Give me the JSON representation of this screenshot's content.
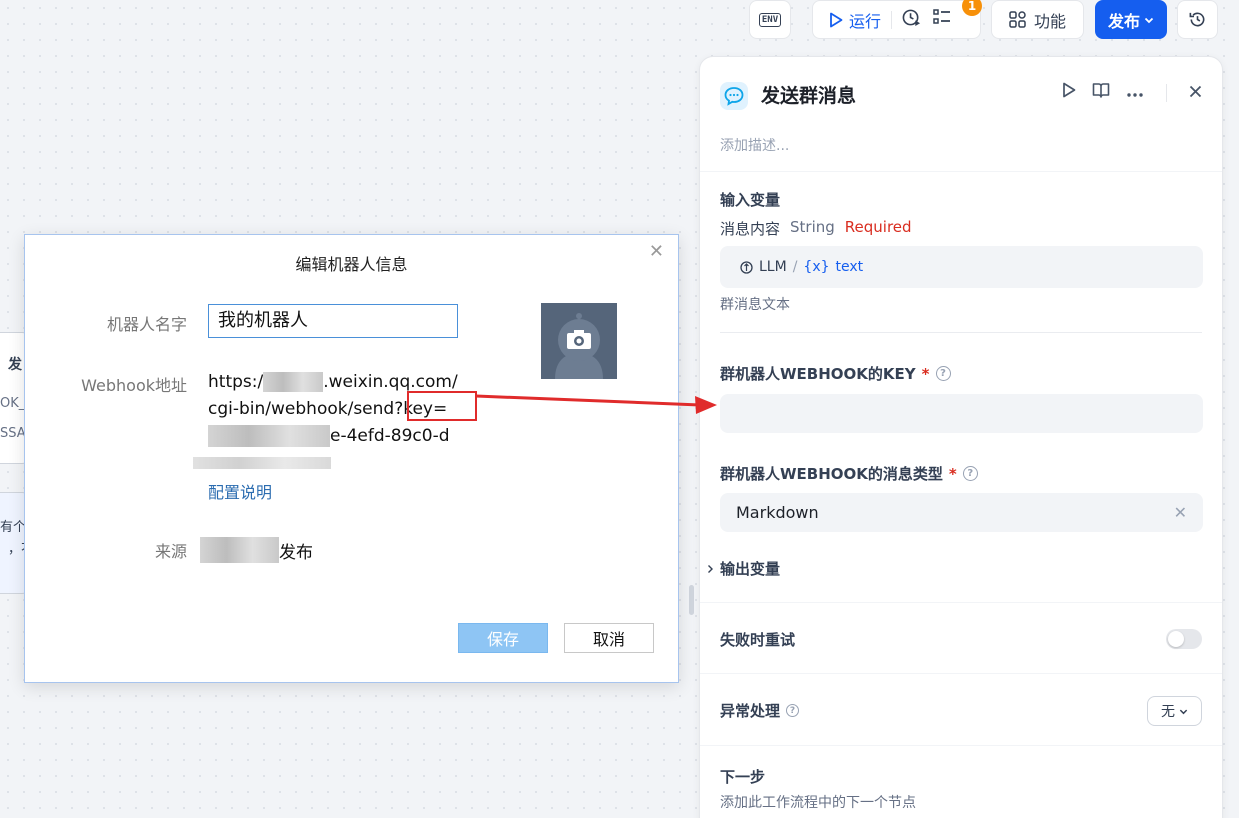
{
  "toolbar": {
    "env_icon": "ENV",
    "run_label": "运行",
    "badge_count": "1",
    "features_label": "功能",
    "publish_label": "发布"
  },
  "panel": {
    "title": "发送群消息",
    "description_placeholder": "添加描述...",
    "input_vars_title": "输入变量",
    "var_name": "消息内容",
    "var_type": "String",
    "var_required": "Required",
    "var_source": "LLM",
    "var_ref": "text",
    "var_hint": "群消息文本",
    "webhook_key_label": "群机器人WEBHOOK的KEY",
    "msg_type_label": "群机器人WEBHOOK的消息类型",
    "msg_type_value": "Markdown",
    "output_vars_title": "输出变量",
    "retry_label": "失败时重试",
    "error_label": "异常处理",
    "error_value": "无",
    "next_step_title": "下一步",
    "next_step_hint": "添加此工作流程中的下一个节点"
  },
  "background_node": {
    "frag1": "发",
    "frag2": "OK_",
    "frag3": "SSA(",
    "frag4": "有个",
    "frag5": "，不"
  },
  "dialog": {
    "title": "编辑机器人信息",
    "name_label": "机器人名字",
    "name_value": "我的机器人",
    "webhook_label": "Webhook地址",
    "webhook_line1_prefix": "https:/",
    "webhook_line1_suffix": ".weixin.qq.com/",
    "webhook_line2": "cgi-bin/webhook/send?key=",
    "webhook_line3_suffix": "e-4efd-89c0-d",
    "config_link": "配置说明",
    "source_label": "来源",
    "source_suffix": "发布",
    "save_label": "保存",
    "cancel_label": "取消"
  },
  "colors": {
    "accent": "#155eef",
    "required": "#d92d20",
    "annotation": "#e02b2b",
    "badge": "#f79009"
  }
}
